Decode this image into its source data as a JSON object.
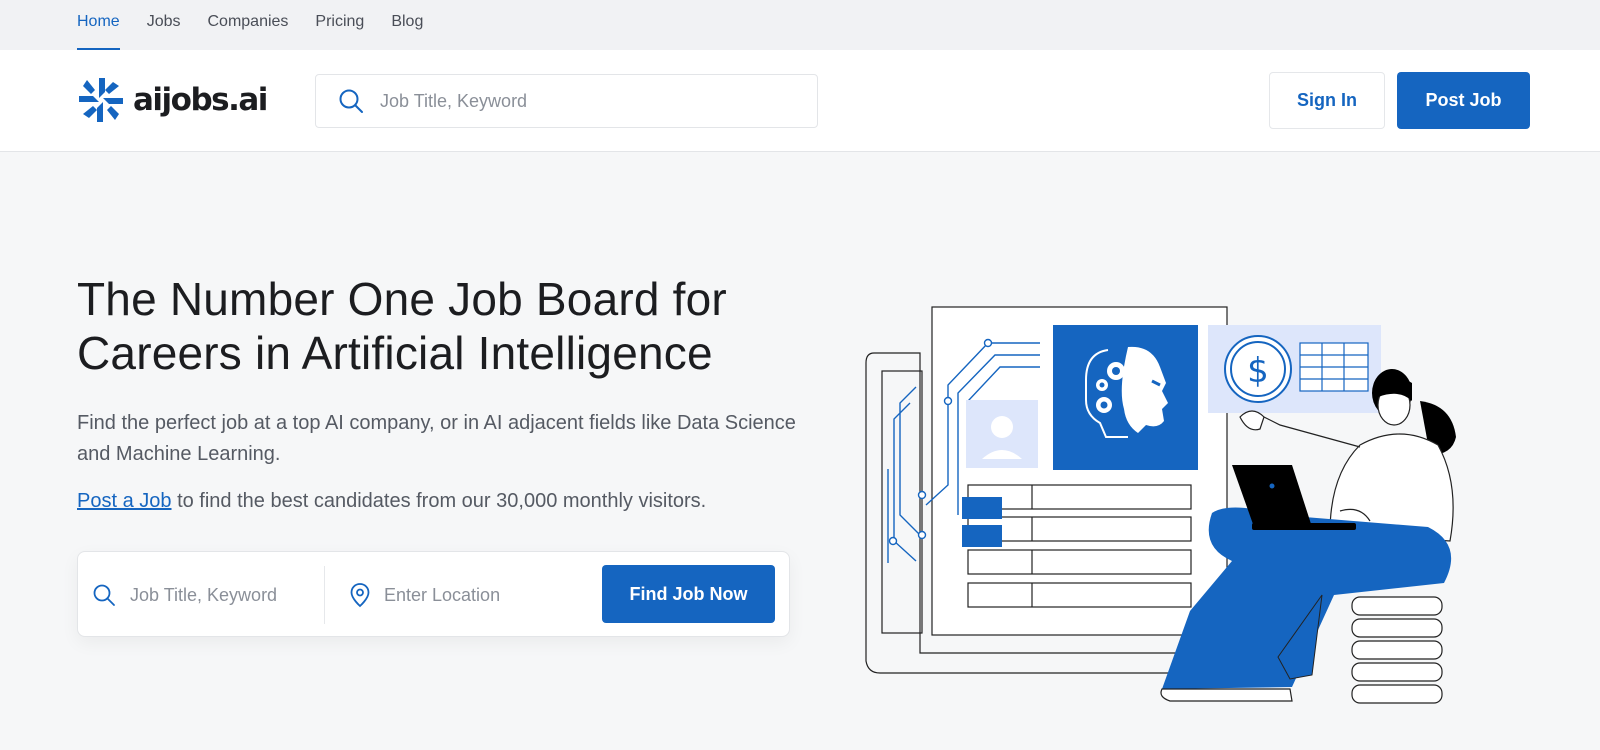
{
  "topnav": {
    "items": [
      {
        "label": "Home",
        "active": true
      },
      {
        "label": "Jobs"
      },
      {
        "label": "Companies"
      },
      {
        "label": "Pricing"
      },
      {
        "label": "Blog"
      }
    ]
  },
  "header": {
    "logo_text": "aijobs.ai",
    "search_placeholder": "Job Title, Keyword",
    "signin_label": "Sign In",
    "postjob_label": "Post Job"
  },
  "hero": {
    "title": "The Number One Job Board for Careers in Artificial Intelligence",
    "subtitle": "Find the perfect job at a top AI company, or in AI adjacent fields like Data Science and Machine Learning.",
    "cta_link": "Post a Job",
    "cta_rest": " to find the best candidates from our 30,000 monthly visitors."
  },
  "search": {
    "keyword_placeholder": "Job Title, Keyword",
    "location_placeholder": "Enter Location",
    "button_label": "Find Job Now"
  },
  "colors": {
    "brand": "#1565c0",
    "text": "#1c1d20",
    "muted": "#555a63",
    "background": "#f6f7f8"
  }
}
